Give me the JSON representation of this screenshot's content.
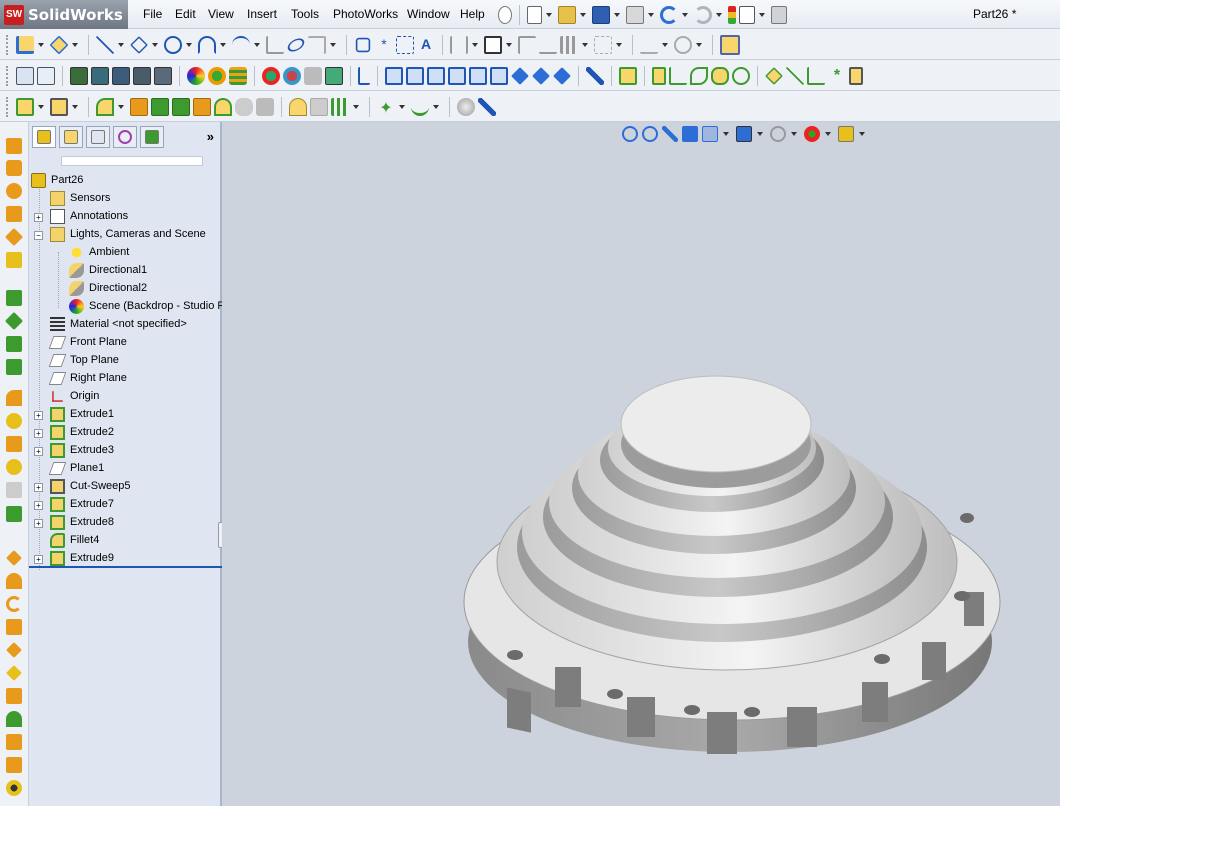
{
  "app": {
    "logo_mark": "SW",
    "logo_name": "SolidWorks",
    "document_title": "Part26 *"
  },
  "menu": [
    "File",
    "Edit",
    "View",
    "Insert",
    "Tools",
    "PhotoWorks",
    "Window",
    "Help"
  ],
  "panel": {
    "expander_glyph": "»",
    "tree": [
      {
        "label": "Part26",
        "icon": "part-icon",
        "level": 0,
        "expander": ""
      },
      {
        "label": "Sensors",
        "icon": "sensors-folder-icon",
        "level": 1,
        "expander": ""
      },
      {
        "label": "Annotations",
        "icon": "annotations-icon",
        "level": 1,
        "expander": "+"
      },
      {
        "label": "Lights, Cameras and Scene",
        "icon": "lights-cameras-scene-icon",
        "level": 1,
        "expander": "−"
      },
      {
        "label": "Ambient",
        "icon": "ambient-light-icon",
        "level": 2,
        "expander": ""
      },
      {
        "label": "Directional1",
        "icon": "directional-light-icon",
        "level": 2,
        "expander": ""
      },
      {
        "label": "Directional2",
        "icon": "directional-light-icon",
        "level": 2,
        "expander": ""
      },
      {
        "label": "Scene (Backdrop - Studio R",
        "icon": "scene-icon",
        "level": 2,
        "expander": ""
      },
      {
        "label": "Material <not specified>",
        "icon": "material-icon",
        "level": 1,
        "expander": ""
      },
      {
        "label": "Front Plane",
        "icon": "plane-icon",
        "level": 1,
        "expander": ""
      },
      {
        "label": "Top Plane",
        "icon": "plane-icon",
        "level": 1,
        "expander": ""
      },
      {
        "label": "Right Plane",
        "icon": "plane-icon",
        "level": 1,
        "expander": ""
      },
      {
        "label": "Origin",
        "icon": "origin-icon",
        "level": 1,
        "expander": ""
      },
      {
        "label": "Extrude1",
        "icon": "extrude-icon",
        "level": 1,
        "expander": "+"
      },
      {
        "label": "Extrude2",
        "icon": "extrude-icon",
        "level": 1,
        "expander": "+"
      },
      {
        "label": "Extrude3",
        "icon": "extrude-icon",
        "level": 1,
        "expander": "+"
      },
      {
        "label": "Plane1",
        "icon": "plane-icon",
        "level": 1,
        "expander": ""
      },
      {
        "label": "Cut-Sweep5",
        "icon": "cut-sweep-icon",
        "level": 1,
        "expander": "+"
      },
      {
        "label": "Extrude7",
        "icon": "extrude-icon",
        "level": 1,
        "expander": "+"
      },
      {
        "label": "Extrude8",
        "icon": "extrude-icon",
        "level": 1,
        "expander": "+"
      },
      {
        "label": "Fillet4",
        "icon": "fillet-icon",
        "level": 1,
        "expander": ""
      },
      {
        "label": "Extrude9",
        "icon": "extrude-icon",
        "level": 1,
        "expander": "+"
      }
    ]
  },
  "colors": {
    "accent": "#1f56b3",
    "orange_icon": "#e89a1c",
    "green_icon": "#3c9a2f",
    "blue_icon": "#2d6ed6",
    "model_light": "#f3f3f3",
    "model_dark": "#7e7e7e"
  }
}
